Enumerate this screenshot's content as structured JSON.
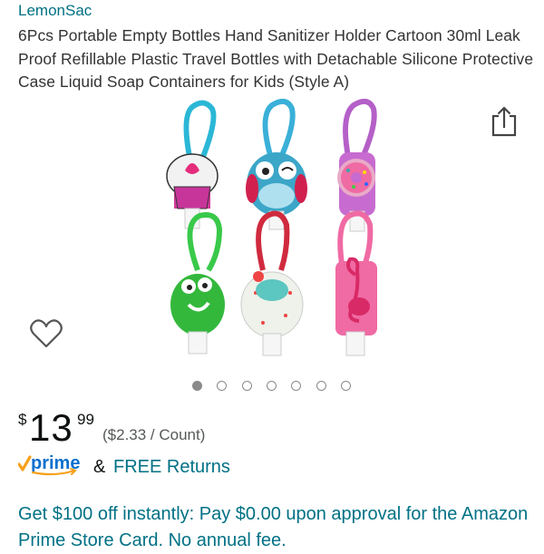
{
  "product": {
    "brand": "LemonSac",
    "title": "6Pcs Portable Empty Bottles Hand Sanitizer Holder Cartoon 30ml Leak Proof Refillable Plastic Travel Bottles with Detachable Silicone Protective Case Liquid Soap Containers for Kids (Style A)"
  },
  "gallery": {
    "total_images": 7,
    "active_index": 0
  },
  "icons": {
    "share": "share-icon",
    "wishlist": "heart-icon",
    "prime": "prime-logo"
  },
  "price": {
    "symbol": "$",
    "whole": "13",
    "fraction": "99",
    "per_unit": "($2.33 / Count)"
  },
  "delivery": {
    "prime_label": "prime",
    "ampersand": "&",
    "free_returns": "FREE Returns"
  },
  "promo": {
    "text": "Get $100 off instantly: Pay $0.00 upon approval for the Amazon Prime Store Card. No annual fee."
  },
  "colors": {
    "link": "#007185",
    "prime_orange": "#F7A11A",
    "prime_blue": "#0C6FCF",
    "text": "#0F1111",
    "secondary": "#565959"
  }
}
